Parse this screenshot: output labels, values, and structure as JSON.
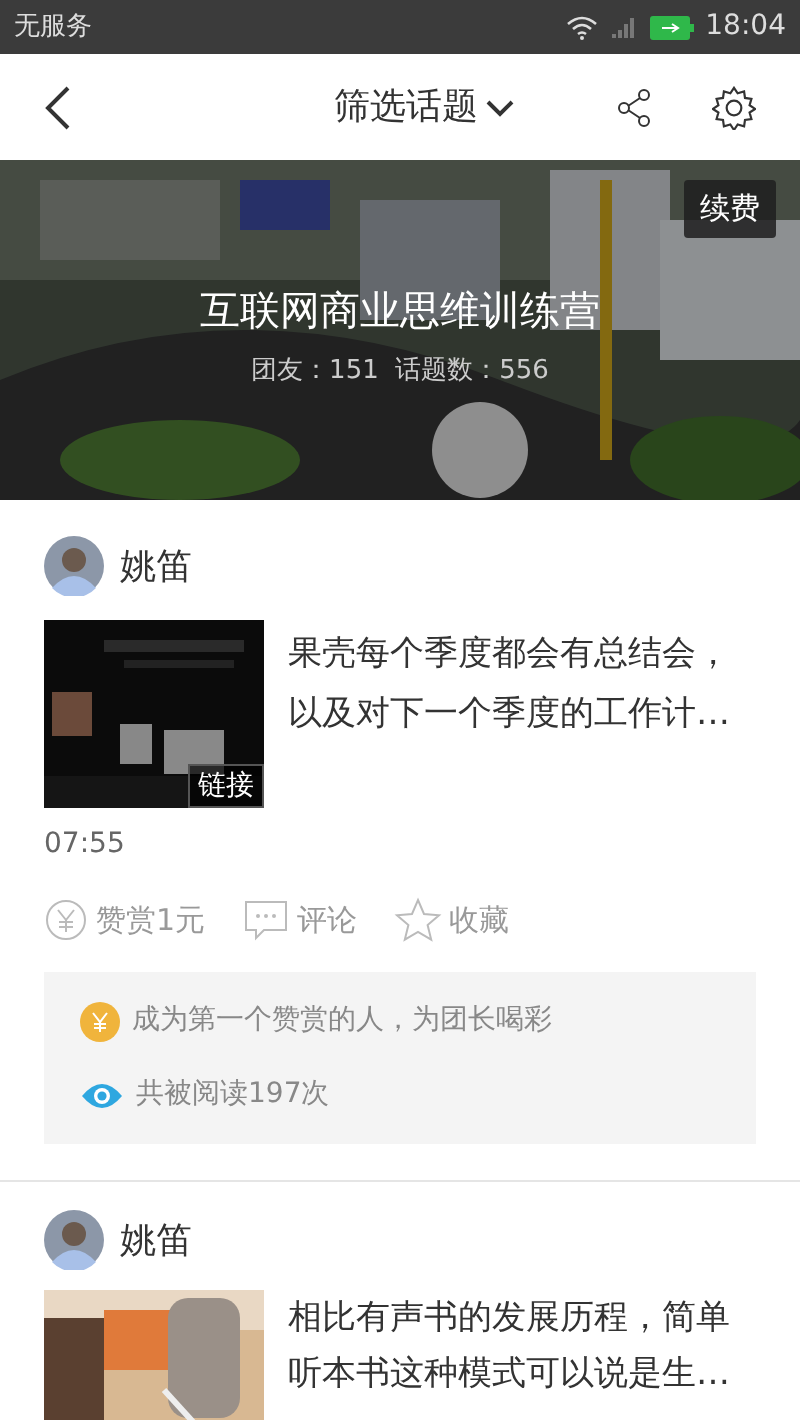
{
  "status_bar": {
    "carrier": "无服务",
    "time": "18:04"
  },
  "header": {
    "title": "筛选话题"
  },
  "banner": {
    "title": "互联网商业思维训练营",
    "stats": "团友：151  话题数：556",
    "renew_button": "续费"
  },
  "posts": [
    {
      "author": "姚笛",
      "text": "果壳每个季度都会有总结会，以及对下一个季度的工作计…",
      "media": {
        "kind": "picture"
      },
      "badge": "链接",
      "time": "07:55",
      "actions": [
        {
          "kind": "reward",
          "label": "赞赏1元"
        },
        {
          "kind": "comment",
          "label": "评论"
        },
        {
          "kind": "favorite",
          "label": "收藏"
        }
      ],
      "info": [
        {
          "kind": "reward",
          "text": "成为第一个赞赏的人，为团长喝彩"
        },
        {
          "kind": "views",
          "text": "共被阅读197次"
        }
      ]
    },
    {
      "author": "姚笛",
      "text": "相比有声书的发展历程，简单听本书这种模式可以说是生…",
      "media": {
        "kind": "picture"
      }
    }
  ]
}
